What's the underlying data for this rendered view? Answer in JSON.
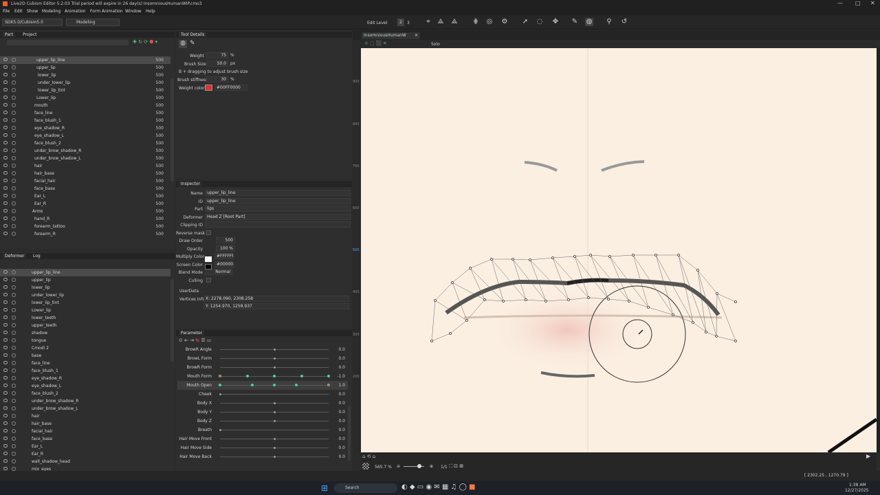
{
  "app": {
    "title": "Live2D Cubism Editor 5.2.03   Trial period will expire in 26 day(s)   InsomniousHumanWIP.cmo3"
  },
  "menu": [
    "File",
    "Edit",
    "Show",
    "Modeling",
    "Animation",
    "Form Animation",
    "Window",
    "Help"
  ],
  "toolbar": {
    "sdk": "SDK5.0/Cubism5.0",
    "mode": "Modeling",
    "edit_level": "Edit Level",
    "level1": "2",
    "level2": "3"
  },
  "part_panel": {
    "tab1": "Part",
    "tab2": "Project",
    "items": [
      {
        "label": "upper_lip_line",
        "value": "500"
      },
      {
        "label": "upper_lip",
        "value": "500"
      },
      {
        "label": "lower_lip",
        "value": "500"
      },
      {
        "label": "under_lower_lip",
        "value": "500"
      },
      {
        "label": "lower_lip_tint",
        "value": "500"
      },
      {
        "label": "Lower_lip",
        "value": "500"
      },
      {
        "label": "mouth",
        "value": "500"
      },
      {
        "label": "face_line",
        "value": "500"
      },
      {
        "label": "face_blush_1",
        "value": "500"
      },
      {
        "label": "eye_shadow_R",
        "value": "500"
      },
      {
        "label": "eye_shadow_L",
        "value": "500"
      },
      {
        "label": "face_blush_2",
        "value": "500"
      },
      {
        "label": "under_brow_shadow_R",
        "value": "500"
      },
      {
        "label": "under_brow_shadow_L",
        "value": "500"
      },
      {
        "label": "hair",
        "value": "500"
      },
      {
        "label": "hair_base",
        "value": "500"
      },
      {
        "label": "facial_hair",
        "value": "500"
      },
      {
        "label": "face_base",
        "value": "500"
      },
      {
        "label": "Ear_L",
        "value": "500"
      },
      {
        "label": "Ear_R",
        "value": "500"
      },
      {
        "label": "Arms",
        "value": "500"
      },
      {
        "label": "hand_R",
        "value": "500"
      },
      {
        "label": "forearm_tattoo",
        "value": "500"
      },
      {
        "label": "forearm_R",
        "value": "500"
      }
    ]
  },
  "deformer_panel": {
    "tab1": "Deformer",
    "tab2": "Log",
    "items": [
      "upper_lip_line",
      "upper_lip",
      "lower_lip",
      "under_lower_lip",
      "lower_lip_tint",
      "Lower_lip",
      "lower_teeth",
      "upper_teeth",
      "shadow",
      "tongue",
      "Cmodi 2",
      "base",
      "face_line",
      "face_blush_1",
      "eye_shadow_R",
      "eye_shadow_L",
      "face_blush_2",
      "under_brow_shadow_R",
      "under_brow_shadow_L",
      "hair",
      "hair_base",
      "facial_hair",
      "face_base",
      "Ear_L",
      "Ear_R",
      "wall_shadow_head",
      "mix_eyes"
    ]
  },
  "tool_details": {
    "tab": "Tool Details",
    "weight_label": "Weight",
    "weight": "75",
    "weight_unit": "%",
    "brush_size_label": "Brush Size",
    "brush_size": "50.0",
    "brush_unit": "px",
    "hint": "B + dragging to adjust brush size",
    "stiffness_label": "Brush stiffness",
    "stiffness": "30",
    "stiffness_unit": "%",
    "weight_color_label": "Weight color",
    "weight_color": "#00FF0000"
  },
  "inspector": {
    "tab": "Inspector",
    "rows": [
      {
        "label": "Name",
        "value": "upper_lip_line"
      },
      {
        "label": "ID",
        "value": "upper_lip_line"
      },
      {
        "label": "Part",
        "value": "lips"
      },
      {
        "label": "Deformer",
        "value": "Head Z  [Root Part]"
      },
      {
        "label": "Clipping ID",
        "value": ""
      },
      {
        "label": "Reverse mask",
        "value": ""
      },
      {
        "label": "Draw Order",
        "value": "500"
      },
      {
        "label": "Opacity",
        "value": "100 %"
      },
      {
        "label": "Multiply Color",
        "value": "#FFFFFF"
      },
      {
        "label": "Screen Color",
        "value": "#000000"
      },
      {
        "label": "Blend Mode",
        "value": "Normal"
      },
      {
        "label": "Culling",
        "value": ""
      }
    ],
    "userdata": "UserData",
    "vertices_label": "Vertices Info",
    "vx": "X: 2278.090, 2308.258",
    "vy": "Y: 1254.970, 1258.937"
  },
  "parameters": {
    "tab": "Parameter",
    "items": [
      {
        "name": "BrowR Angle",
        "value": "0.0",
        "pos": 0.5
      },
      {
        "name": "BrowL Form",
        "value": "0.0",
        "pos": 0.5
      },
      {
        "name": "BrowR Form",
        "value": "0.0",
        "pos": 0.5
      },
      {
        "name": "Mouth Form",
        "value": "-1.0",
        "pos": 0.0,
        "keys": [
          0,
          0.25,
          0.5,
          0.75,
          1
        ]
      },
      {
        "name": "Mouth Open",
        "value": "1.0",
        "pos": 1.0,
        "keys": [
          0,
          0.3,
          0.5,
          0.7,
          1
        ]
      },
      {
        "name": "Cheek",
        "value": "0.0",
        "pos": 0.0
      },
      {
        "name": "Body X",
        "value": "0.0",
        "pos": 0.5
      },
      {
        "name": "Body Y",
        "value": "0.0",
        "pos": 0.5
      },
      {
        "name": "Body Z",
        "value": "0.0",
        "pos": 0.5
      },
      {
        "name": "Breath",
        "value": "0.0",
        "pos": 0.0
      },
      {
        "name": "Hair Move Front",
        "value": "0.0",
        "pos": 0.5
      },
      {
        "name": "Hair Move Side",
        "value": "0.0",
        "pos": 0.5
      },
      {
        "name": "Hair Move Back",
        "value": "0.0",
        "pos": 0.5
      }
    ]
  },
  "viewport": {
    "tab": "InsomniousHumanW",
    "solo": "Solo",
    "zoom": "565.7 %",
    "ratio": "1/1",
    "coords": "[ 2302.25 , 1270.79 ]",
    "ruler": [
      "900",
      "800",
      "700",
      "600",
      "500",
      "400",
      "300",
      "200"
    ]
  },
  "taskbar": {
    "search": "Search",
    "time": "1:38 AM",
    "date": "12/27/2025"
  }
}
